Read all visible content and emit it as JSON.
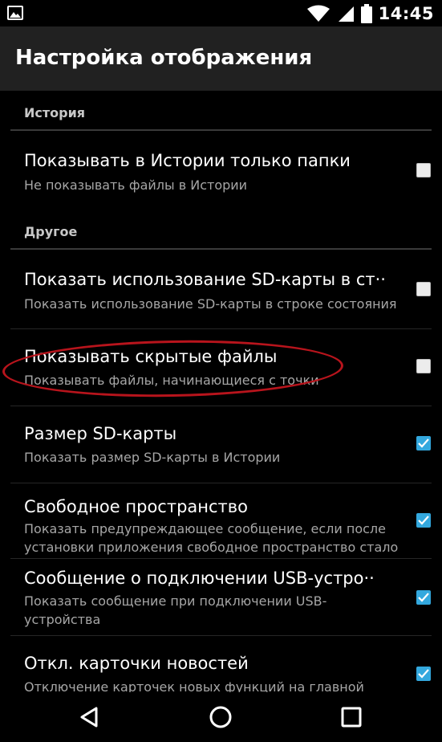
{
  "status_bar": {
    "time": "14:45",
    "icons": [
      "gallery-icon",
      "wifi-icon",
      "signal-icon",
      "battery-icon"
    ]
  },
  "app_bar": {
    "title": "Настройка отображения"
  },
  "categories": [
    {
      "label": "История",
      "items": [
        {
          "title": "Показывать в Истории только папки",
          "summary": "Не показывать файлы в Истории",
          "checked": false
        }
      ]
    },
    {
      "label": "Другое",
      "items": [
        {
          "title": "Показать использование SD-карты в ст··",
          "summary": "Показать использование SD-карты в строке состояния",
          "checked": false
        },
        {
          "title": "Показывать скрытые файлы",
          "summary": "Показывать файлы, начинающиеся с точки",
          "checked": false
        },
        {
          "title": "Размер SD-карты",
          "summary": "Показать размер SD-карты в Истории",
          "checked": true
        },
        {
          "title": "Свободное пространство",
          "summary": "Показать предупреждающее сообщение, если после установки приложения свободное пространство стало ниже минимального уровня",
          "checked": true
        },
        {
          "title": "Сообщение о подключении USB-устро··",
          "summary": "Показать сообщение при подключении USB-устройства",
          "checked": true
        },
        {
          "title": "Откл. карточки новостей",
          "summary": "Отключение карточек новых функций на главной",
          "checked": true
        }
      ]
    }
  ],
  "colors": {
    "accent": "#33a8de",
    "app_bar": "#212121",
    "background": "#000000",
    "highlight": "#b8141c"
  },
  "nav_bar": [
    "back-icon",
    "home-icon",
    "recents-icon"
  ]
}
